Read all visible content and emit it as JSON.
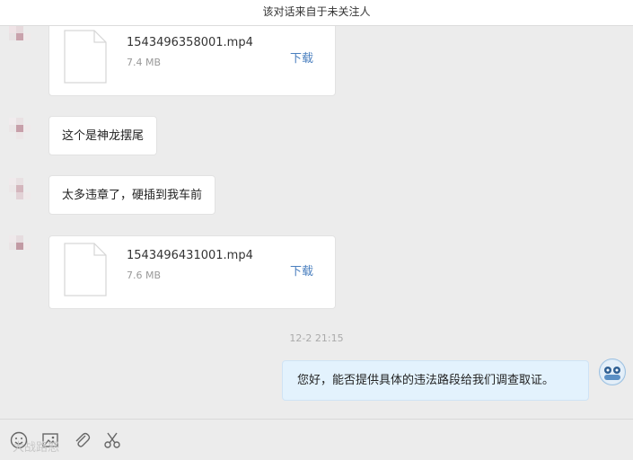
{
  "header": {
    "title": "该对话来自于未关注人"
  },
  "messages": {
    "file1": {
      "name": "1543496358001.mp4",
      "size": "7.4 MB",
      "download": "下载"
    },
    "text1": "这个是神龙摆尾",
    "text2": "太多违章了，硬插到我车前",
    "file2": {
      "name": "1543496431001.mp4",
      "size": "7.6 MB",
      "download": "下载"
    },
    "timestamp": "12-2 21:15",
    "reply": "您好，能否提供具体的违法路段给我们调查取证。"
  },
  "toolbar": {
    "tools": [
      "emoji-icon",
      "image-icon",
      "attachment-icon",
      "scissors-icon"
    ],
    "watermark": "大战路怒"
  },
  "colors": {
    "download_link": "#4a7fbf",
    "my_bubble": "#e3f2fd",
    "background": "#ececec"
  }
}
